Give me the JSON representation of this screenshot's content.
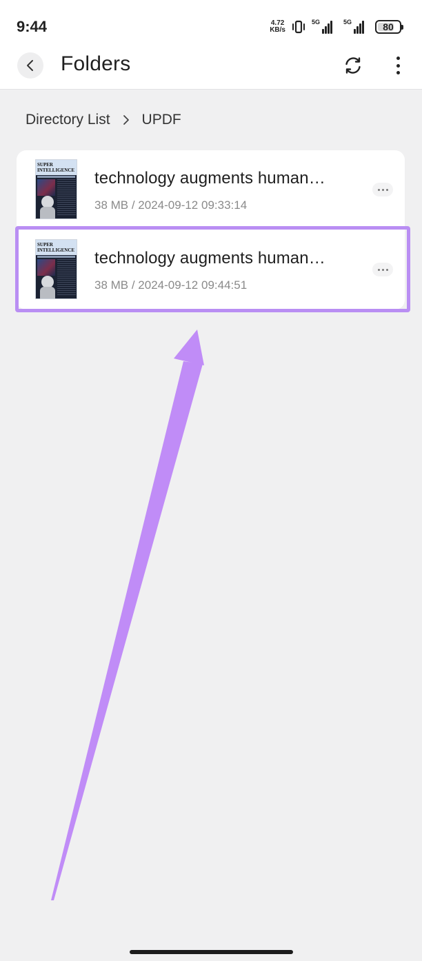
{
  "status_bar": {
    "time": "9:44",
    "net_speed_value": "4.72",
    "net_speed_unit": "KB/s",
    "sim1_label": "5G",
    "sim2_label": "5G",
    "battery": "80"
  },
  "header": {
    "title": "Folders",
    "back_icon": "chevron-left-icon",
    "refresh_icon": "refresh-icon",
    "more_icon": "vertical-dots-icon"
  },
  "breadcrumb": {
    "items": [
      "Directory List",
      "UPDF"
    ]
  },
  "files": [
    {
      "name": "technology augments human…",
      "meta": "38 MB / 2024-09-12 09:33:14",
      "thumb_title": "SUPER INTELLIGENCE"
    },
    {
      "name": "technology augments human…",
      "meta": "38 MB / 2024-09-12 09:44:51",
      "thumb_title": "SUPER INTELLIGENCE"
    }
  ],
  "colors": {
    "highlight": "#b98ef3",
    "arrow": "#c08cf7"
  }
}
